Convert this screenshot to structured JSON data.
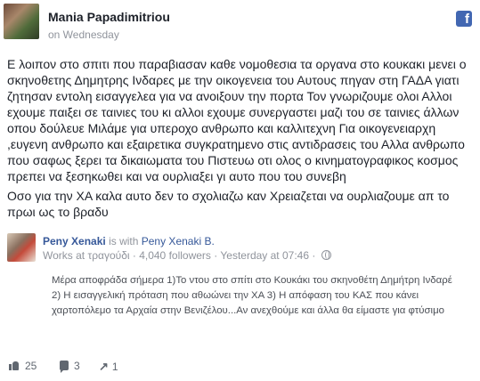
{
  "post": {
    "author": "Mania Papadimitriou",
    "timestamp": "on Wednesday",
    "platform_icon": "facebook-logo-icon",
    "paragraphs": [
      [
        "Ε λοιπον στο σπιτι που παραβιασαν καθε νομοθεσια τα οργανα στο κουκακι μενει ο",
        "σκηνοθετης Δημητρης Ινδαρες με την οικογενεια του Αυτους πηγαν στη ΓΑΔΑ γιατι",
        "ζητησαν εντολη εισαγγελεα για να ανοιξουν την πορτα Τον γνωριζουμε ολοι Αλλοι",
        "εχουμε παιξει σε ταινιες του κι αλλοι εχουμε συνεργαστει μαζι του σε ταινιες άλλων",
        "οπου δούλευε Μιλάμε για υπεροχο ανθρωπο και καλλιτεχνη Για οικογενειαρχη",
        ",ευγενη ανθρωπο και εξαιρετικα συγκρατημενο στις αντιδρασεις του Αλλα ανθρωπο",
        "που σαφως ξερει τα δικαιωματα του Πιστευω οτι ολος ο κινηματογραφικος κοσμος",
        "πρεπει να ξεσηκωθει και να ουρλιαξει γι αυτο που του συνεβη"
      ],
      [
        "Οσο για την ΧΑ καλα αυτο δεν το σχολιαζω καν Χρειαζεται να ουρλιαζουμε απ το",
        "πρωι ως το βραδυ"
      ]
    ]
  },
  "shared": {
    "author": "Peny Xenaki",
    "is_with_text": "is with",
    "with_name": "Peny Xenaki B.",
    "subtitle": "Works at τραγούδι · 4,040 followers · Yesterday at 07:46 ·",
    "text_lines": [
      "Μέρα αποφράδα σήμερα 1)Το ντου στο σπίτι στο Κουκάκι του σκηνοθέτη Δημήτρη Ινδαρέ",
      "2) Η εισαγγελική πρόταση που αθωώνει την ΧΑ 3) Η απόφαση του ΚΑΣ που κάνει",
      "χαρτοπόλεμο τα Αρχαία στην Βενιζέλου...Αν ανεχθούμε και άλλα θα είμαστε για φτύσιμο"
    ]
  },
  "footer": {
    "likes": "25",
    "comments": "3",
    "shares": "1"
  }
}
